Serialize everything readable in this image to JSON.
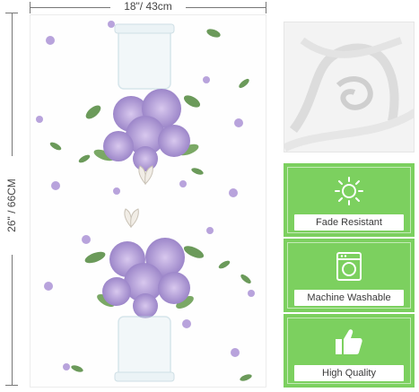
{
  "dimensions": {
    "width_label": "18\"/ 43cm",
    "height_label": "26\" / 66CM"
  },
  "features": [
    {
      "label": "Fade Resistant",
      "icon": "sun-icon"
    },
    {
      "label": "Machine Washable",
      "icon": "washing-machine-icon"
    },
    {
      "label": "High Quality",
      "icon": "thumbs-up-icon"
    }
  ],
  "colors": {
    "feature_green": "#7cd05f",
    "hydrangea": "#b49ad6",
    "leaf": "#6b9a5a"
  }
}
